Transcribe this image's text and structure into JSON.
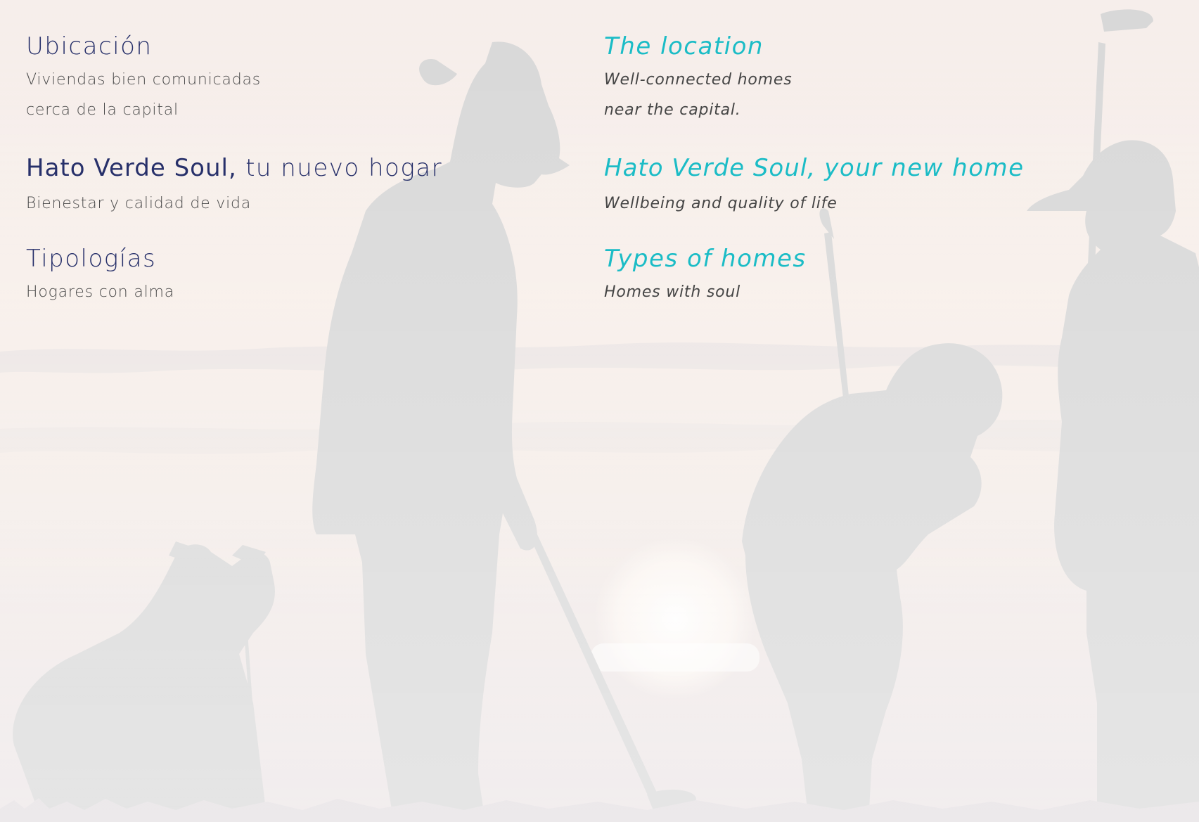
{
  "spanish": {
    "location": {
      "title": "Ubicación",
      "lines": [
        "Viviendas bien comunicadas",
        "cerca de la capital"
      ]
    },
    "home": {
      "title_brand": "Hato Verde Soul,",
      "title_rest": " tu nuevo hogar",
      "lines": [
        "Bienestar y calidad de vida"
      ]
    },
    "types": {
      "title": "Tipologías",
      "lines": [
        "Hogares con alma"
      ]
    }
  },
  "english": {
    "location": {
      "title": "The location",
      "lines": [
        "Well-connected homes",
        "near the capital."
      ]
    },
    "home": {
      "title_brand": "Hato Verde Soul,",
      "title_rest": " your new home",
      "lines": [
        "Wellbeing and quality of life"
      ]
    },
    "types": {
      "title": "Types of homes",
      "lines": [
        "Homes with soul"
      ]
    }
  },
  "colors": {
    "spanish_heading": "#27306a",
    "english_heading": "#1bbcc6",
    "body_text": "#4a4a4a",
    "silhouette": "#d8d8d8"
  }
}
